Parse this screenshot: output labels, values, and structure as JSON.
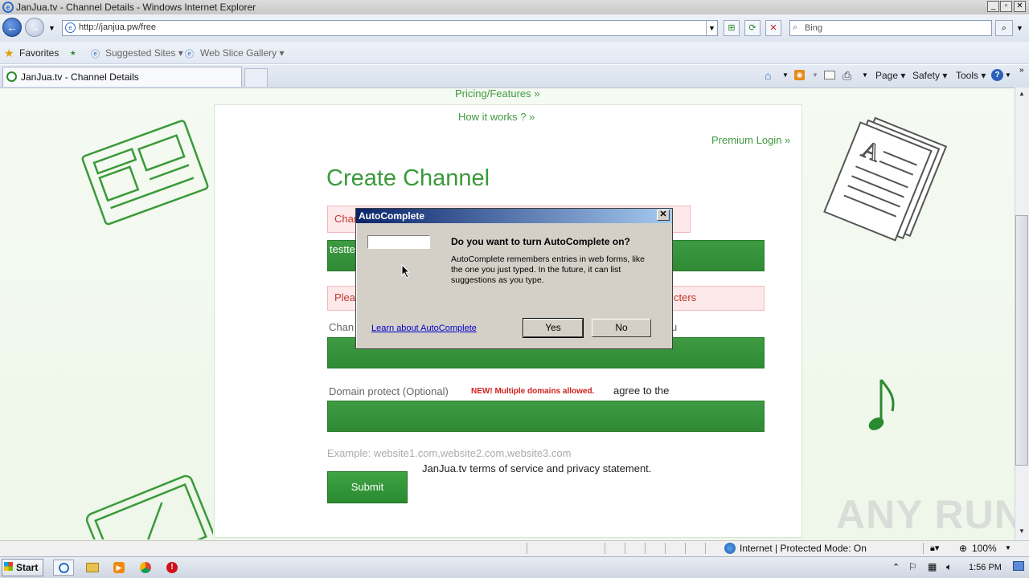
{
  "window": {
    "title": "JanJua.tv - Channel Details - Windows Internet Explorer"
  },
  "address_bar": {
    "url": "http://janjua.pw/free",
    "search_placeholder": "Bing"
  },
  "favorites_bar": {
    "favorites_label": "Favorites",
    "items": [
      "Suggested Sites ▾",
      "Web Slice Gallery ▾"
    ]
  },
  "tabs": [
    {
      "label": "JanJua.tv - Channel Details"
    }
  ],
  "command_bar": {
    "page": "Page ▾",
    "safety": "Safety ▾",
    "tools": "Tools ▾"
  },
  "page": {
    "nav_pricing": "Pricing/Features »",
    "nav_how": "How it works ? »",
    "nav_premium": "Premium Login »",
    "heading": "Create Channel",
    "msg1_partial": "Chan",
    "field1_value": "testte",
    "msg2_left": "Plea",
    "msg2_right": "cters",
    "channel_label_partial": "Chan",
    "channel_label_tail": "u",
    "domain_label": "Domain protect (Optional)",
    "domain_new": "NEW! Multiple domains allowed.",
    "agree_text": "agree to the",
    "example_text": "Example: website1.com,website2.com,website3.com",
    "terms_text": "JanJua.tv terms of service and privacy statement.",
    "submit_label": "Submit"
  },
  "dialog": {
    "title": "AutoComplete",
    "question": "Do you want to turn AutoComplete on?",
    "body": "AutoComplete remembers entries in web forms, like the one you just typed. In the future, it can list suggestions as you type.",
    "learn_link": "Learn about AutoComplete",
    "yes_label": "Yes",
    "no_label": "No"
  },
  "status_bar": {
    "zone": "Internet | Protected Mode: On",
    "zoom": "100%"
  },
  "taskbar": {
    "start_label": "Start",
    "clock": "1:56 PM"
  },
  "watermark": "ANY RUN",
  "colors": {
    "accent_green": "#3a9a3a",
    "error_pink": "#fde8ea",
    "dialog_title": "#0a246a"
  }
}
